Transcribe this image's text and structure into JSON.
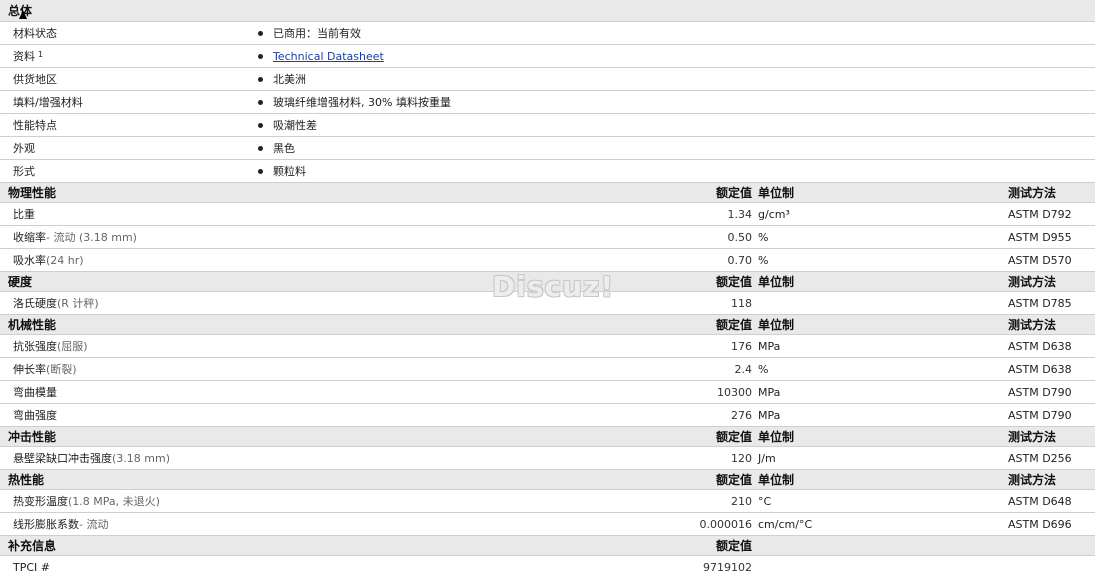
{
  "general": {
    "header": "总体",
    "rows": [
      {
        "label": "材料状态",
        "value": "已商用：当前有效"
      },
      {
        "label": "资料",
        "sup": "1",
        "value": "Technical Datasheet"
      },
      {
        "label": "供货地区",
        "value": "北美洲"
      },
      {
        "label": "填料/增强材料",
        "value": "玻璃纤维增强材料, 30% 填料按重量"
      },
      {
        "label": "性能特点",
        "value": "吸潮性差"
      },
      {
        "label": "外观",
        "value": "黑色"
      },
      {
        "label": "形式",
        "value": "颗粒料"
      }
    ]
  },
  "columns": {
    "value": "额定值",
    "unit": "单位制",
    "method": "测试方法"
  },
  "physical": {
    "header": "物理性能",
    "rows": [
      {
        "label": "比重",
        "cond": "",
        "value": "1.34",
        "unit": "g/cm³",
        "method": "ASTM D792"
      },
      {
        "label": "收缩率",
        "cond": " - 流动 (3.18 mm)",
        "value": "0.50",
        "unit": "%",
        "method": "ASTM D955"
      },
      {
        "label": "吸水率",
        "cond": " (24 hr)",
        "value": "0.70",
        "unit": "%",
        "method": "ASTM D570"
      }
    ]
  },
  "hardness": {
    "header": "硬度",
    "rows": [
      {
        "label": "洛氏硬度",
        "cond": " (R 计秤)",
        "value": "118",
        "unit": "",
        "method": "ASTM D785"
      }
    ]
  },
  "mechanical": {
    "header": "机械性能",
    "rows": [
      {
        "label": "抗张强度",
        "cond": " (屈服)",
        "value": "176",
        "unit": "MPa",
        "method": "ASTM D638"
      },
      {
        "label": "伸长率",
        "cond": " (断裂)",
        "value": "2.4",
        "unit": "%",
        "method": "ASTM D638"
      },
      {
        "label": "弯曲模量",
        "cond": "",
        "value": "10300",
        "unit": "MPa",
        "method": "ASTM D790"
      },
      {
        "label": "弯曲强度",
        "cond": "",
        "value": "276",
        "unit": "MPa",
        "method": "ASTM D790"
      }
    ]
  },
  "impact": {
    "header": "冲击性能",
    "rows": [
      {
        "label": "悬壁梁缺口冲击强度",
        "cond": " (3.18 mm)",
        "value": "120",
        "unit": "J/m",
        "method": "ASTM D256"
      }
    ]
  },
  "thermal": {
    "header": "热性能",
    "rows": [
      {
        "label": "热变形温度",
        "cond": " (1.8 MPa, 未退火)",
        "value": "210",
        "unit": "°C",
        "method": "ASTM D648"
      },
      {
        "label": "线形膨胀系数",
        "cond": " - 流动",
        "value": "0.000016",
        "unit": "cm/cm/°C",
        "method": "ASTM D696"
      }
    ]
  },
  "supplemental": {
    "header": "补充信息",
    "rows": [
      {
        "label": "TPCI #",
        "cond": "",
        "value": "9719102",
        "unit": "",
        "method": ""
      }
    ]
  },
  "watermark": "Discuz!"
}
